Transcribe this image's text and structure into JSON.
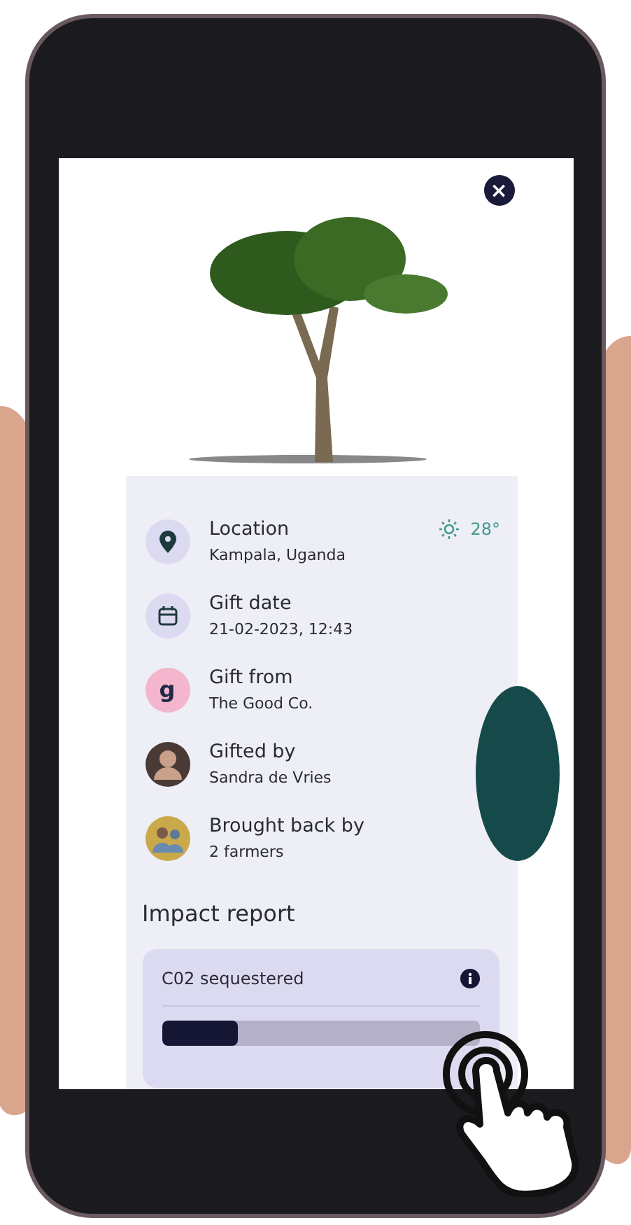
{
  "close_button": {
    "label": "×"
  },
  "weather": {
    "temperature": "28°"
  },
  "details": [
    {
      "kind": "location",
      "title": "Location",
      "value": "Kampala, Uganda"
    },
    {
      "kind": "date",
      "title": "Gift date",
      "value": "21-02-2023, 12:43"
    },
    {
      "kind": "logo",
      "logo_text": "g",
      "title": "Gift from",
      "value": "The Good Co."
    },
    {
      "kind": "avatar",
      "title": "Gifted by",
      "value": "Sandra de Vries"
    },
    {
      "kind": "group",
      "title": "Brought back by",
      "value": "2 farmers"
    }
  ],
  "impact": {
    "heading": "Impact report",
    "card_title": "C02 sequestered",
    "level": 0.24
  }
}
